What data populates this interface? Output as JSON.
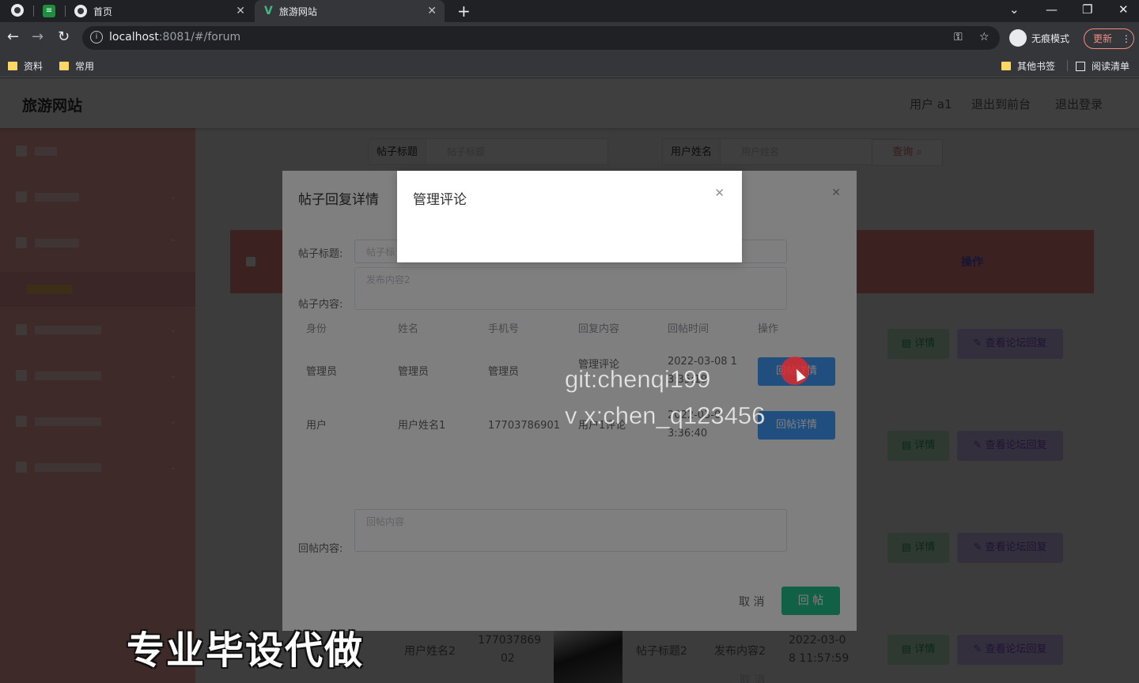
{
  "browser": {
    "tabs": [
      {
        "label": "首页"
      },
      {
        "label": "旅游网站"
      }
    ],
    "url_host": "localhost",
    "url_path": ":8081/#/forum",
    "incognito_label": "无痕模式",
    "update_label": "更新",
    "bookmarks": [
      "资料",
      "常用"
    ],
    "other_bookmarks": "其他书签",
    "reading_list": "阅读清单"
  },
  "header": {
    "title": "旅游网站",
    "user": "用户 a1",
    "back_front": "退出到前台",
    "logout": "退出登录"
  },
  "search": {
    "title_label": "帖子标题",
    "title_placeholder": "帖子标题",
    "user_label": "用户姓名",
    "user_placeholder": "用户姓名",
    "query": "查询"
  },
  "table": {
    "op_header": "操作",
    "detail": "详情",
    "view_reply": "查看论坛回复",
    "last_row": {
      "name": "用户姓名2",
      "phone_1": "177037869",
      "phone_2": "02",
      "title": "帖子标题2",
      "content": "发布内容2",
      "time_1": "2022-03-0",
      "time_2": "8 11:57:59"
    }
  },
  "reply_dialog": {
    "title": "帖子回复详情",
    "post_title_label": "帖子标题:",
    "post_content_label": "帖子内容:",
    "post_title_value": "帖子标",
    "post_content_value": "发布内容2",
    "columns": [
      "身份",
      "姓名",
      "手机号",
      "回复内容",
      "回帖时间",
      "操作"
    ],
    "rows": [
      {
        "role": "管理员",
        "name": "管理员",
        "phone": "管理员",
        "content": "管理评论",
        "time": "2022-03-08 1",
        "time_2": "3:35:19",
        "action": "回帖详情"
      },
      {
        "role": "用户",
        "name": "用户姓名1",
        "phone": "17703786901",
        "content": "用户1评论",
        "time": "2022-03-0",
        "time_2": "3:36:40",
        "action": "回帖详情"
      }
    ],
    "reply_label": "回帖内容:",
    "reply_placeholder": "回帖内容",
    "cancel": "取 消",
    "submit": "回 帖"
  },
  "comment_dialog": {
    "title": "管理评论"
  },
  "watermarks": {
    "line1": "git:chenqi199",
    "line2": "v x:chen_q123456",
    "big": "专业毕设代做"
  },
  "colors": {
    "sidebar": "#f4a8a6",
    "table_head": "#f08686",
    "accent_green": "#22c38e",
    "accent_purple": "#7b4fd0"
  }
}
